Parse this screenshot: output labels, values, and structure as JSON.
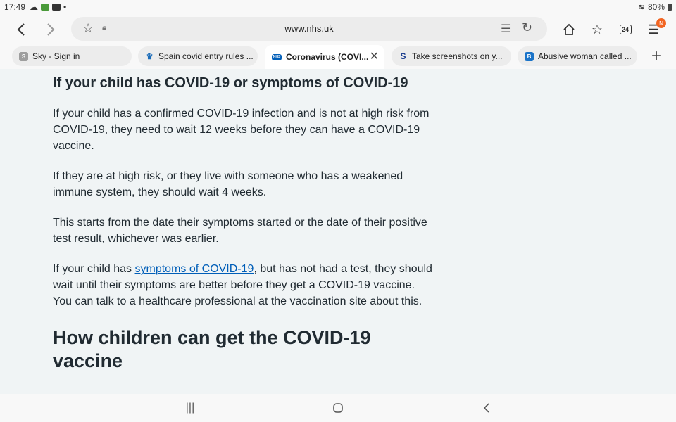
{
  "status_bar": {
    "time": "17:49",
    "battery": "80%"
  },
  "browser": {
    "url": "www.nhs.uk",
    "tab_count": "24",
    "menu_badge": "N"
  },
  "tabs": [
    {
      "title": "Sky - Sign in",
      "icon": "sky-favicon",
      "icon_text": "S",
      "active": false
    },
    {
      "title": "Spain covid entry rules ...",
      "icon": "spain-favicon",
      "icon_text": "",
      "active": false
    },
    {
      "title": "Coronavirus (COVI...",
      "icon": "nhs-favicon",
      "icon_text": "NHS",
      "active": true
    },
    {
      "title": "Take screenshots on y...",
      "icon": "s-favicon",
      "icon_text": "S",
      "active": false
    },
    {
      "title": "Abusive woman called ...",
      "icon": "b-favicon",
      "icon_text": "B",
      "active": false
    }
  ],
  "page": {
    "heading": "If your child has COVID-19 or symptoms of COVID-19",
    "para1": "If your child has a confirmed COVID-19 infection and is not at high risk from COVID-19, they need to wait 12 weeks before they can have a COVID-19 vaccine.",
    "para2": "If they are at high risk, or they live with someone who has a weakened immune system, they should wait 4 weeks.",
    "para3": "This starts from the date their symptoms started or the date of their positive test result, whichever was earlier.",
    "para4_before": "If your child has ",
    "para4_link": "symptoms of COVID-19",
    "para4_after": ", but has not had a test, they should wait until their symptoms are better before they get a COVID-19 vaccine. You can talk to a healthcare professional at the vaccination site about this.",
    "heading2": "How children can get the COVID-19 vaccine"
  },
  "colors": {
    "nhs_blue": "#005eb8",
    "page_bg": "#f0f4f5",
    "text": "#212b32",
    "badge": "#f26522"
  }
}
